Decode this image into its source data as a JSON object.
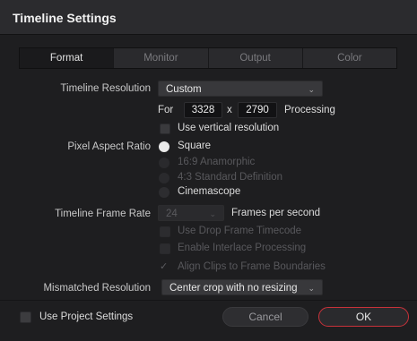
{
  "dialog": {
    "title": "Timeline Settings"
  },
  "tabs": [
    {
      "label": "Format",
      "active": true
    },
    {
      "label": "Monitor",
      "active": false
    },
    {
      "label": "Output",
      "active": false
    },
    {
      "label": "Color",
      "active": false
    }
  ],
  "format": {
    "resolution": {
      "label": "Timeline Resolution",
      "value": "Custom",
      "for_label": "For",
      "width": "3328",
      "x_label": "x",
      "height": "2790",
      "processing_label": "Processing",
      "vertical_label": "Use vertical resolution"
    },
    "pixel_aspect": {
      "label": "Pixel Aspect Ratio",
      "options": [
        {
          "label": "Square",
          "selected": true,
          "enabled": true
        },
        {
          "label": "16:9 Anamorphic",
          "selected": false,
          "enabled": false
        },
        {
          "label": "4:3 Standard Definition",
          "selected": false,
          "enabled": false
        },
        {
          "label": "Cinemascope",
          "selected": false,
          "enabled": true
        }
      ]
    },
    "frame_rate": {
      "label": "Timeline Frame Rate",
      "value": "24",
      "unit": "Frames per second",
      "drop_frame_label": "Use Drop Frame Timecode",
      "interlace_label": "Enable Interlace Processing",
      "align_label": "Align Clips to Frame Boundaries"
    },
    "mismatched": {
      "label": "Mismatched Resolution",
      "value": "Center crop with no resizing"
    }
  },
  "footer": {
    "project_settings_label": "Use Project Settings",
    "cancel_label": "Cancel",
    "ok_label": "OK"
  },
  "colors": {
    "ok_border": "#c8323a",
    "background": "#1e1e20",
    "titlebar": "#2b2b2e"
  }
}
